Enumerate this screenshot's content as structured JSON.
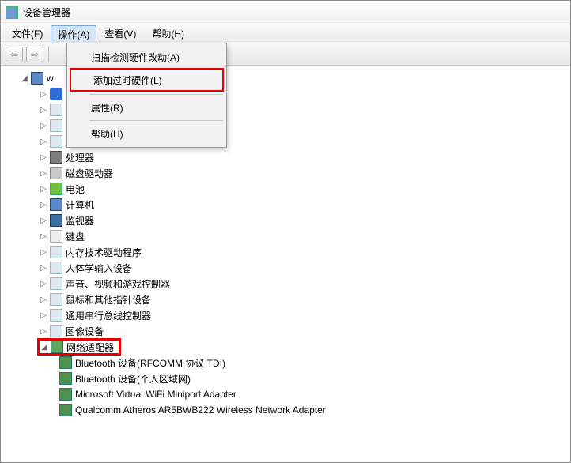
{
  "title": "设备管理器",
  "menubar": {
    "file": "文件(F)",
    "action": "操作(A)",
    "view": "查看(V)",
    "help": "帮助(H)"
  },
  "dropdown": {
    "scan": "扫描检测硬件改动(A)",
    "addLegacy": "添加过时硬件(L)",
    "properties": "属性(R)",
    "help": "帮助(H)"
  },
  "tree": {
    "root": "w",
    "cpu": "处理器",
    "disk": "磁盘驱动器",
    "battery": "电池",
    "computer": "计算机",
    "monitor": "监视器",
    "keyboard": "键盘",
    "mem": "内存技术驱动程序",
    "hid": "人体学输入设备",
    "sound": "声音、视频和游戏控制器",
    "mouse": "鼠标和其他指针设备",
    "usb": "通用串行总线控制器",
    "imaging": "图像设备",
    "net": "网络适配器",
    "net_items": {
      "bt1": "Bluetooth 设备(RFCOMM 协议 TDI)",
      "bt2": "Bluetooth 设备(个人区域网)",
      "wifi": "Microsoft Virtual WiFi Miniport Adapter",
      "ath": "Qualcomm Atheros AR5BWB222 Wireless Network Adapter"
    }
  }
}
